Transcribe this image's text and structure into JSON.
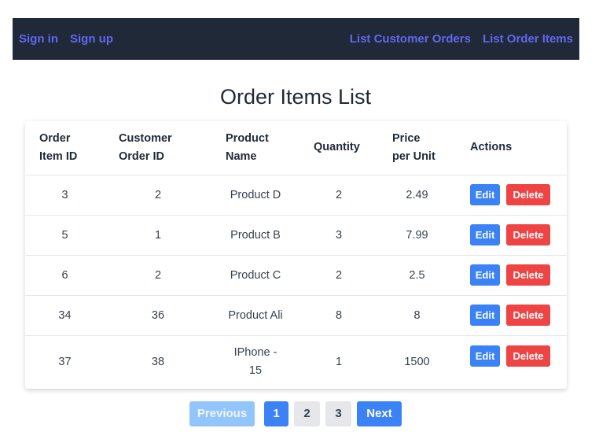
{
  "nav": {
    "left": [
      "Sign in",
      "Sign up"
    ],
    "right": [
      "List Customer Orders",
      "List Order Items"
    ]
  },
  "page": {
    "title": "Order Items List"
  },
  "table": {
    "headers": [
      [
        "Order",
        "Item ID"
      ],
      [
        "Customer",
        "Order ID"
      ],
      [
        "Product",
        "Name"
      ],
      [
        "Quantity"
      ],
      [
        "Price",
        "per Unit"
      ],
      [
        "Actions"
      ]
    ],
    "rows": [
      {
        "id": "3",
        "customer_order_id": "2",
        "product": "Product D",
        "quantity": "2",
        "price": "2.49"
      },
      {
        "id": "5",
        "customer_order_id": "1",
        "product": "Product B",
        "quantity": "3",
        "price": "7.99"
      },
      {
        "id": "6",
        "customer_order_id": "2",
        "product": "Product C",
        "quantity": "2",
        "price": "2.5"
      },
      {
        "id": "34",
        "customer_order_id": "36",
        "product": "Product Ali",
        "quantity": "8",
        "price": "8"
      },
      {
        "id": "37",
        "customer_order_id": "38",
        "product": [
          "IPhone -",
          "15"
        ],
        "quantity": "1",
        "price": "1500"
      }
    ],
    "edit_label": "Edit",
    "delete_label": "Delete"
  },
  "pagination": {
    "previous": "Previous",
    "pages": [
      "1",
      "2",
      "3"
    ],
    "current": "1",
    "next": "Next"
  },
  "colors": {
    "navbar_bg": "#1f2937",
    "nav_link": "#6366f1",
    "primary": "#3b82f6",
    "danger": "#ef4444",
    "disabled": "#93c5fd"
  }
}
